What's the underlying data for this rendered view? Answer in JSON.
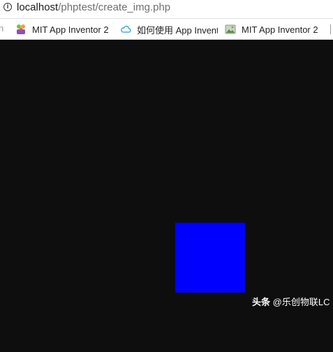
{
  "address_bar": {
    "host": "localhost",
    "path": "/phptest/create_img.php"
  },
  "bookmarks": {
    "items": [
      {
        "label": "MIT App Inventor 2",
        "icon": "mit-app-inventor-icon"
      },
      {
        "label": "如何使用 App Invent",
        "icon": "cloud-icon"
      },
      {
        "label": "MIT App Inventor 2",
        "icon": "image-icon"
      }
    ]
  },
  "canvas": {
    "background": "#0e0e0e",
    "shape_color": "#0000ff"
  },
  "watermark": {
    "brand": "头条",
    "handle": "@乐创物联LC"
  }
}
